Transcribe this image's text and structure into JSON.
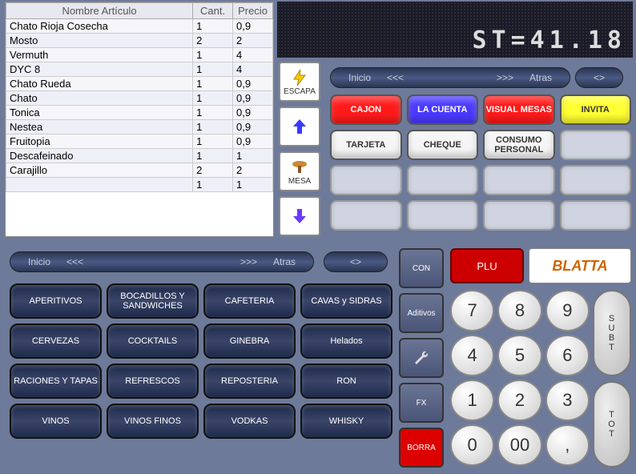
{
  "display_text": "ST=41.18",
  "table": {
    "headers": [
      "Nombre Artículo",
      "Cant.",
      "Precio"
    ],
    "rows": [
      {
        "name": "Chato Rioja Cosecha",
        "qty": "1",
        "price": "0,9"
      },
      {
        "name": "Mosto",
        "qty": "2",
        "price": "2"
      },
      {
        "name": "Vermuth",
        "qty": "1",
        "price": "4"
      },
      {
        "name": "DYC 8",
        "qty": "1",
        "price": "4"
      },
      {
        "name": "Chato Rueda",
        "qty": "1",
        "price": "0,9"
      },
      {
        "name": "Chato",
        "qty": "1",
        "price": "0,9"
      },
      {
        "name": "Tonica",
        "qty": "1",
        "price": "0,9"
      },
      {
        "name": "Nestea",
        "qty": "1",
        "price": "0,9"
      },
      {
        "name": "Fruitopia",
        "qty": "1",
        "price": "0,9"
      },
      {
        "name": "Descafeinado",
        "qty": "1",
        "price": "1"
      },
      {
        "name": "Carajillo",
        "qty": "2",
        "price": "2"
      },
      {
        "name": "",
        "qty": "1",
        "price": "1"
      }
    ]
  },
  "nav": {
    "inicio": "Inicio",
    "back": "<<<",
    "fwd": ">>>",
    "atras": "Atras",
    "toggle": "<>"
  },
  "icon_buttons": {
    "escapa": "ESCAPA",
    "mesa": "MESA"
  },
  "pay_buttons": {
    "row1": [
      {
        "label": "CAJON",
        "cls": "red"
      },
      {
        "label": "LA CUENTA",
        "cls": "blue"
      },
      {
        "label": "VISUAL MESAS",
        "cls": "red"
      },
      {
        "label": "INVITA",
        "cls": "yellow"
      }
    ],
    "row2": [
      {
        "label": "TARJETA",
        "cls": "white"
      },
      {
        "label": "CHEQUE",
        "cls": "white"
      },
      {
        "label": "CONSUMO PERSONAL",
        "cls": "white"
      },
      {
        "label": "",
        "cls": "empty"
      }
    ],
    "row3": [
      {
        "label": "",
        "cls": "empty"
      },
      {
        "label": "",
        "cls": "empty"
      },
      {
        "label": "",
        "cls": "empty"
      },
      {
        "label": "",
        "cls": "empty"
      }
    ],
    "row4": [
      {
        "label": "",
        "cls": "empty"
      },
      {
        "label": "",
        "cls": "empty"
      },
      {
        "label": "",
        "cls": "empty"
      },
      {
        "label": "",
        "cls": "empty"
      }
    ]
  },
  "categories": [
    "APERITIVOS",
    "BOCADILLOS Y SANDWICHES",
    "CAFETERIA",
    "CAVAS y SIDRAS",
    "CERVEZAS",
    "COCKTAILS",
    "GINEBRA",
    "Helados",
    "RACIONES Y TAPAS",
    "REFRESCOS",
    "REPOSTERIA",
    "RON",
    "VINOS",
    "VINOS FINOS",
    "VODKAS",
    "WHISKY"
  ],
  "side": {
    "con": "CON",
    "aditivos": "Aditivos",
    "fx": "FX",
    "borra": "BORRA",
    "plu": "PLU"
  },
  "logo": "BLATTA",
  "numpad": [
    "7",
    "8",
    "9",
    "4",
    "5",
    "6",
    "1",
    "2",
    "3",
    "0",
    "00",
    ","
  ],
  "tall": {
    "subt": "SUBT",
    "tot": "TOT"
  }
}
